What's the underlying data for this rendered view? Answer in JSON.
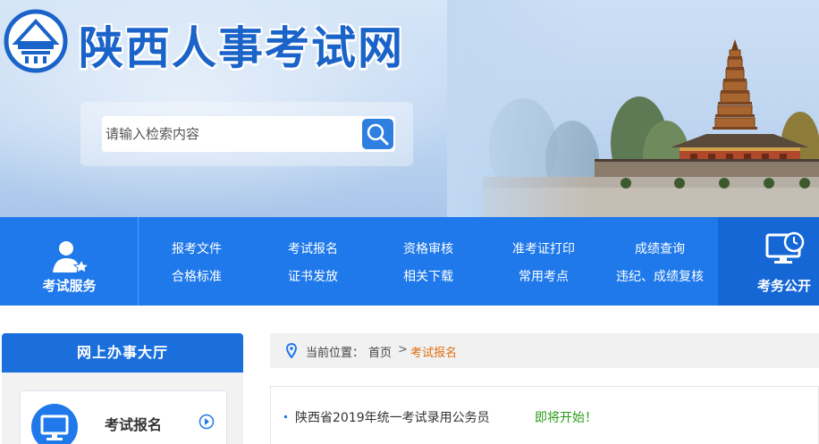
{
  "header": {
    "site_title": "陕西人事考试网",
    "logo_icon": "pagoda-logo-icon"
  },
  "search": {
    "placeholder": "请输入检索内容",
    "button_icon": "search-icon"
  },
  "service_bar": {
    "left_label": "考试服务",
    "left_icon": "user-star-icon",
    "links": [
      "报考文件",
      "考试报名",
      "资格审核",
      "准考证打印",
      "成绩查询",
      "合格标准",
      "证书发放",
      "相关下载",
      "常用考点",
      "违纪、成绩复核"
    ],
    "right_label": "考务公开",
    "right_icon": "monitor-clock-icon"
  },
  "hall": {
    "title": "网上办事大厅",
    "card_label": "考试报名",
    "card_icon": "computer-icon",
    "card_arrow": "arrow-right-circle-icon"
  },
  "breadcrumb": {
    "prefix": "当前位置：",
    "home": "首页",
    "separator": ">",
    "current": "考试报名"
  },
  "news": {
    "title": "陕西省2019年统一考试录用公务员",
    "status": "即将开始！"
  },
  "colors": {
    "primary": "#1f79ea",
    "dark_primary": "#1567d6",
    "title_blue": "#1a63c9",
    "breadcrumb_current": "#e06d10",
    "status_green": "#2a9a19"
  }
}
